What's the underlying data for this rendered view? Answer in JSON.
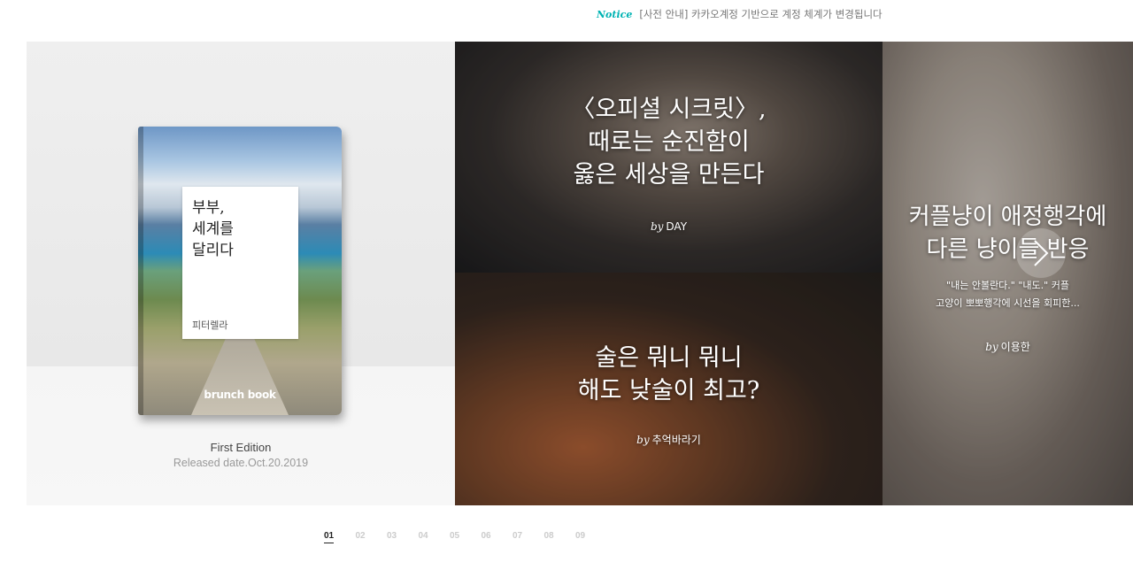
{
  "notice": {
    "label": "Notice",
    "text": "[사전 안내] 카카오계정 기반으로 계정 체계가 변경됩니다"
  },
  "book": {
    "title": "부부,\n세계를\n달리다",
    "author": "피터렐라",
    "brand": "brunch book",
    "edition": "First Edition",
    "released": "Released date.Oct.20.2019"
  },
  "articles": [
    {
      "title": "〈오피셜 시크릿〉,\n때로는 순진함이\n옳은 세상을 만든다",
      "by": "by",
      "author": "DAY"
    },
    {
      "title": "술은 뭐니 뭐니\n해도 낮술이 최고?",
      "by": "by",
      "author": "추억바라기"
    },
    {
      "title": "커플냥이 애정행각에\n다른 냥이들 반응",
      "description": "\"내는 안볼란다.\" \"내도.\" 커플\n고양이 뽀뽀행각에 시선을 회피한...",
      "by": "by",
      "author": "이용한"
    }
  ],
  "pagination": {
    "pages": [
      "01",
      "02",
      "03",
      "04",
      "05",
      "06",
      "07",
      "08",
      "09"
    ],
    "active": "01"
  },
  "icons": {
    "next": "chevron-right-icon"
  },
  "colors": {
    "notice_label": "#00b3b3"
  }
}
